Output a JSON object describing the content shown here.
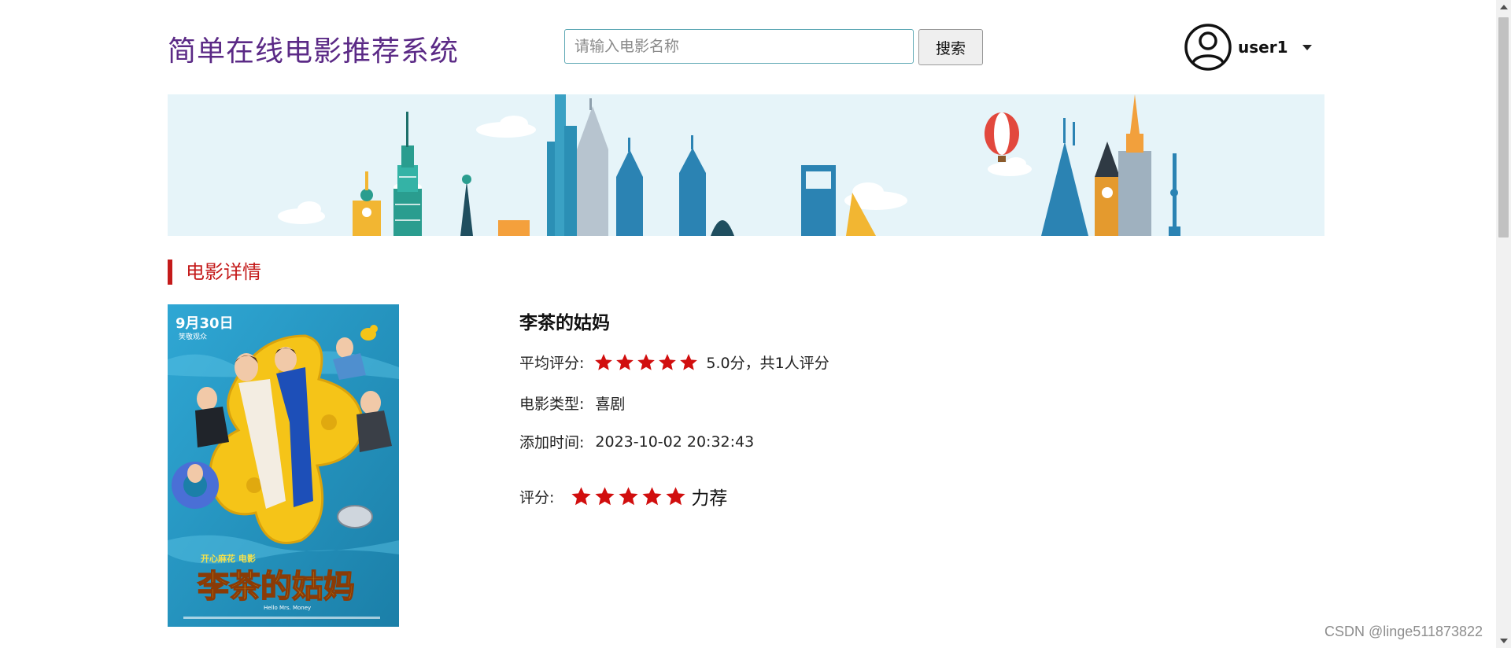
{
  "header": {
    "site_title": "简单在线电影推荐系统",
    "search_placeholder": "请输入电影名称",
    "search_value": "",
    "search_button": "搜索",
    "username": "user1"
  },
  "section": {
    "title": "电影详情"
  },
  "movie": {
    "title": "李茶的姑妈",
    "avg_rating_label": "平均评分:",
    "avg_rating_stars": 5,
    "avg_rating_text": "5.0分，共1人评分",
    "genre_label": "电影类型:",
    "genre": "喜剧",
    "added_label": "添加时间:",
    "added_time": "2023-10-02 20:32:43",
    "poster": {
      "date": "9月30日",
      "tagline": "笑敬观众",
      "studio": "开心麻花 电影",
      "title_art": "李茶的姑妈",
      "subtitle": "Hello Mrs. Money"
    }
  },
  "user_rating": {
    "label": "评分:",
    "stars": 5,
    "text": "力荐"
  },
  "colors": {
    "title_purple": "#5b2a86",
    "accent_red": "#c41a1a",
    "star_red": "#d10e0e",
    "banner_bg": "#e6f4f9"
  },
  "watermark": "CSDN @linge511873822"
}
